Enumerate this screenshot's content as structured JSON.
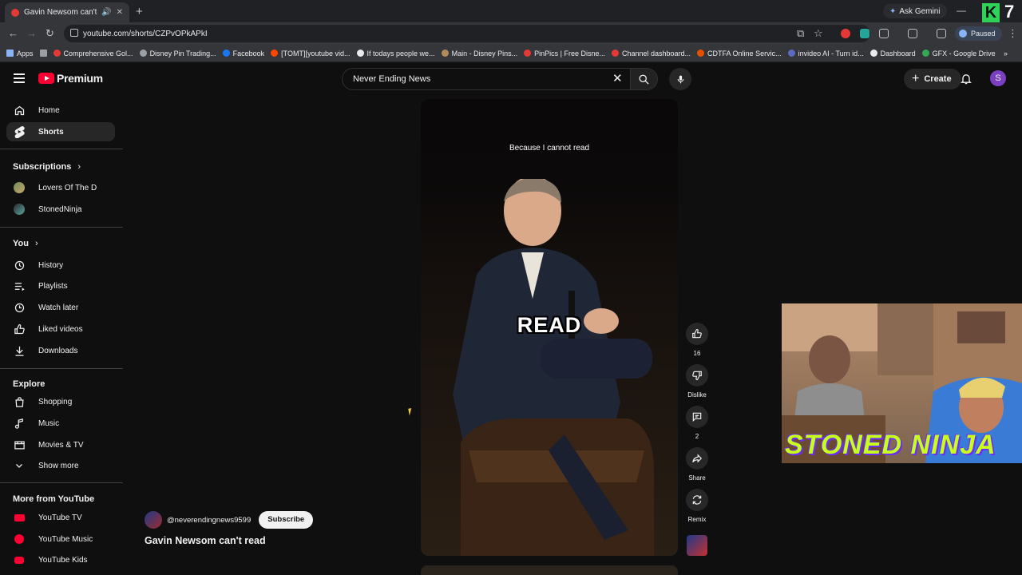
{
  "browser": {
    "tab_title": "Gavin Newsom can't read",
    "ask_gemini": "Ask Gemini",
    "url": "youtube.com/shorts/CZPvOPkAPkI",
    "profile_status": "Paused",
    "overlay_number": "7",
    "bookmarks": [
      {
        "label": "Apps",
        "color": "#8ab4f8"
      },
      {
        "label": "",
        "color": "#9aa0a6"
      },
      {
        "label": "Comprehensive Gol...",
        "color": "#e53935"
      },
      {
        "label": "Disney Pin Trading...",
        "color": "#9aa0a6"
      },
      {
        "label": "Facebook",
        "color": "#1877f2"
      },
      {
        "label": "[TOMT][youtube vid...",
        "color": "#ff4500"
      },
      {
        "label": "If todays people we...",
        "color": "#e8eaed"
      },
      {
        "label": "Main - Disney Pins...",
        "color": "#b38b59"
      },
      {
        "label": "PinPics | Free Disne...",
        "color": "#e53935"
      },
      {
        "label": "Channel dashboard...",
        "color": "#e53935"
      },
      {
        "label": "CDTFA Online Servic...",
        "color": "#e65100"
      },
      {
        "label": "invideo AI - Turn id...",
        "color": "#5c6bc0"
      },
      {
        "label": "Dashboard",
        "color": "#e8eaed"
      },
      {
        "label": "GFX - Google Drive",
        "color": "#34a853"
      }
    ]
  },
  "header": {
    "logo_text": "Premium",
    "search_query": "Never Ending News",
    "create_label": "Create",
    "avatar_letter": "S"
  },
  "sidebar": {
    "main": [
      {
        "label": "Home",
        "icon": "home-icon"
      },
      {
        "label": "Shorts",
        "icon": "shorts-icon",
        "active": true
      }
    ],
    "subscriptions_title": "Subscriptions",
    "subscriptions": [
      {
        "label": "Lovers Of The D"
      },
      {
        "label": "StonedNinja"
      }
    ],
    "you_title": "You",
    "you_items": [
      {
        "label": "History"
      },
      {
        "label": "Playlists"
      },
      {
        "label": "Watch later"
      },
      {
        "label": "Liked videos"
      },
      {
        "label": "Downloads"
      }
    ],
    "explore_title": "Explore",
    "explore_items": [
      {
        "label": "Shopping"
      },
      {
        "label": "Music"
      },
      {
        "label": "Movies & TV"
      },
      {
        "label": "Show more"
      }
    ],
    "more_title": "More from YouTube",
    "more_items": [
      {
        "label": "YouTube TV"
      },
      {
        "label": "YouTube Music"
      },
      {
        "label": "YouTube Kids"
      }
    ]
  },
  "video": {
    "caption": "Because I cannot read",
    "big_word": "READ",
    "channel_handle": "@neverendingnews9599",
    "subscribe_label": "Subscribe",
    "title": "Gavin Newsom can't read"
  },
  "actions": {
    "like_count": "16",
    "dislike_label": "Dislike",
    "comment_count": "2",
    "share_label": "Share",
    "remix_label": "Remix"
  },
  "overlay": {
    "webcam_text": "STONED NINJA"
  }
}
